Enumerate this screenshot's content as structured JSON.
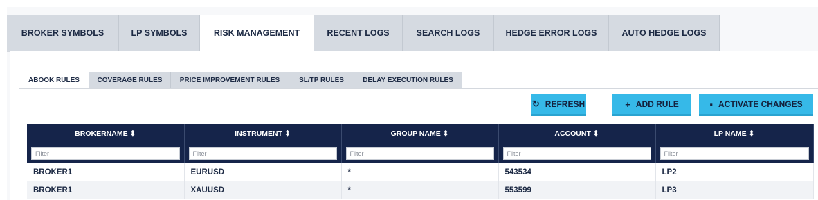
{
  "top_tabs": [
    "BROKER SYMBOLS",
    "LP SYMBOLS",
    "RISK MANAGEMENT",
    "RECENT LOGS",
    "SEARCH LOGS",
    "HEDGE ERROR LOGS",
    "AUTO HEDGE LOGS"
  ],
  "active_top_tab": "RISK MANAGEMENT",
  "sub_tabs": [
    "ABOOK RULES",
    "COVERAGE RULES",
    "PRICE IMPROVEMENT RULES",
    "SL/TP RULES",
    "DELAY EXECUTION RULES"
  ],
  "active_sub_tab": "ABOOK RULES",
  "buttons": {
    "refresh": {
      "label": "REFRESH",
      "icon": "refresh-icon"
    },
    "add_rule": {
      "label": "ADD RULE",
      "icon": "plus-icon"
    },
    "activate": {
      "label": "ACTIVATE CHANGES",
      "icon": "save-icon"
    }
  },
  "table": {
    "columns": [
      "BROKERNAME ⬍",
      "INSTRUMENT ⬍",
      "GROUP NAME ⬍",
      "ACCOUNT ⬍",
      "LP NAME ⬍"
    ],
    "filter_placeholder": "Filter",
    "rows": [
      [
        "BROKER1",
        "EURUSD",
        "*",
        "543534",
        "LP2"
      ],
      [
        "BROKER1",
        "XAUUSD",
        "*",
        "553599",
        "LP3"
      ]
    ]
  },
  "colors": {
    "header_bg": "#15244a",
    "button_bg": "#36b9e8",
    "tab_bg": "#d5dae1"
  }
}
